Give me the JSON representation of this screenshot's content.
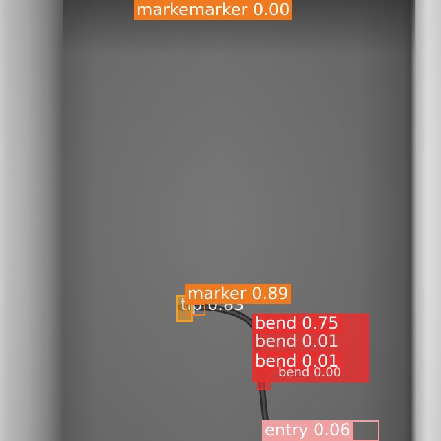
{
  "image": {
    "description_icon": "xray-catheter-scene"
  },
  "detections": {
    "top_marker": "markemarker 0.00",
    "tip": "tip 0.83",
    "marker": "marker 0.89",
    "bend_1": "bend 0.75",
    "bend_2": "bend 0.01",
    "bend_3": "bend 0.01",
    "bend_4": "bend 0.00",
    "entry": "entry 0.06"
  },
  "colors": {
    "marker": "#f07a20",
    "tip": "#f0a020",
    "bend": "#e53030",
    "entry": "#f0a0a0"
  }
}
